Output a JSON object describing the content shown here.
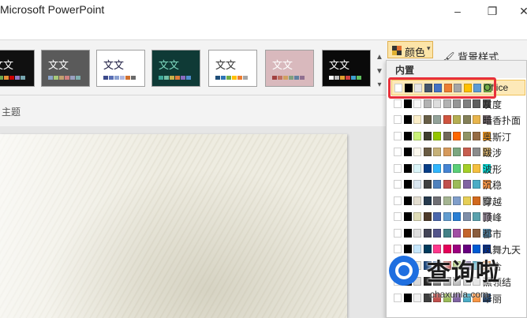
{
  "window": {
    "title": "Microsoft PowerPoint",
    "min_label": "–",
    "restore_label": "❐",
    "close_label": "✕"
  },
  "ribbon": {
    "group_label": "主题",
    "colors_button": "颜色",
    "bg_style": "背景样式",
    "themes": [
      {
        "text": "文文",
        "bg": "#101010",
        "fg": "#ffffff",
        "bars": [
          "#4a6fa5",
          "#6aa84f",
          "#e69138",
          "#cc0000",
          "#8e7cc3",
          "#76a5af"
        ]
      },
      {
        "text": "文文",
        "bg": "#5a5a5a",
        "fg": "#ffffff",
        "bars": [
          "#8aa4c8",
          "#a7c97a",
          "#c4a070",
          "#d08080",
          "#9aa0c0",
          "#80b0b0"
        ]
      },
      {
        "text": "文文",
        "bg": "#ffffff",
        "fg": "#1a1a40",
        "bars": [
          "#3c4a8a",
          "#5a70b5",
          "#8aa0d0",
          "#b0b8e0",
          "#d07030",
          "#6a6a6a"
        ]
      },
      {
        "text": "文文",
        "bg": "#0f3a36",
        "fg": "#7fd8c0",
        "bars": [
          "#3fa99a",
          "#74c0a8",
          "#c7b04a",
          "#e07b3c",
          "#8a6bbf",
          "#4f8fd0"
        ]
      },
      {
        "text": "文文",
        "bg": "#ffffff",
        "fg": "#333333",
        "bars": [
          "#1f4e79",
          "#2e75b6",
          "#70ad47",
          "#ffc000",
          "#ed7d31",
          "#a5a5a5"
        ]
      },
      {
        "text": "文文",
        "bg": "#d9b9bd",
        "fg": "#ffffff",
        "bars": [
          "#a04040",
          "#c07060",
          "#d0a060",
          "#80a080",
          "#6080a0",
          "#907090"
        ]
      },
      {
        "text": "文文",
        "bg": "#0a0a0a",
        "fg": "#ffffff",
        "bars": [
          "#ffffff",
          "#c0c0c0",
          "#e0a030",
          "#d04040",
          "#40a0d0",
          "#60c060"
        ]
      }
    ]
  },
  "dropdown": {
    "header": "内置",
    "rows": [
      {
        "label": "Office",
        "colors": [
          "#ffffff",
          "#000000",
          "#e7e6e6",
          "#44546a",
          "#4472c4",
          "#ed7d31",
          "#a5a5a5",
          "#ffc000",
          "#5b9bd5",
          "#70ad47"
        ],
        "hover": true
      },
      {
        "label": "灰度",
        "colors": [
          "#ffffff",
          "#000000",
          "#f8f8f8",
          "#b2b2b2",
          "#dddddd",
          "#b2b2b2",
          "#969696",
          "#808080",
          "#5f5f5f",
          "#4d4d4d"
        ]
      },
      {
        "label": "暗香扑面",
        "colors": [
          "#ffffff",
          "#000000",
          "#fbeec9",
          "#675e47",
          "#93a299",
          "#cf543f",
          "#b5ae53",
          "#848058",
          "#e8b54d",
          "#786c71"
        ]
      },
      {
        "label": "奥斯汀",
        "colors": [
          "#ffffff",
          "#000000",
          "#caf278",
          "#3e3d2d",
          "#94c600",
          "#71685a",
          "#ff6700",
          "#909465",
          "#956b43",
          "#fea022"
        ]
      },
      {
        "label": "跋涉",
        "colors": [
          "#ffffff",
          "#000000",
          "#fbf8ee",
          "#695b43",
          "#c6b178",
          "#d69a5c",
          "#7ca780",
          "#c75e4f",
          "#8c8c8c",
          "#d6b26f"
        ]
      },
      {
        "label": "波形",
        "colors": [
          "#ffffff",
          "#000000",
          "#dbf5f9",
          "#073e87",
          "#31b6fd",
          "#4584d3",
          "#5bd078",
          "#a5d028",
          "#f5c040",
          "#05e0db"
        ]
      },
      {
        "label": "沉稳",
        "colors": [
          "#ffffff",
          "#000000",
          "#d9e6f0",
          "#404040",
          "#4f81bd",
          "#c0504d",
          "#9bbb59",
          "#8064a2",
          "#4bacc6",
          "#f79646"
        ]
      },
      {
        "label": "穿越",
        "colors": [
          "#ffffff",
          "#000000",
          "#e3ded1",
          "#263a4d",
          "#6f6f74",
          "#a5b592",
          "#809eca",
          "#e6cf57",
          "#d2691e",
          "#a5a5a5"
        ]
      },
      {
        "label": "顶峰",
        "colors": [
          "#ffffff",
          "#000000",
          "#dfdcb7",
          "#4d3a2a",
          "#4a66ac",
          "#629dd1",
          "#297fd5",
          "#7f8fa9",
          "#5aa2ae",
          "#9d90a0"
        ]
      },
      {
        "label": "都市",
        "colors": [
          "#ffffff",
          "#000000",
          "#dedede",
          "#424456",
          "#53548a",
          "#438086",
          "#a04da3",
          "#c4652d",
          "#8b5d3d",
          "#5c92b5"
        ]
      },
      {
        "label": "凤舞九天",
        "colors": [
          "#ffffff",
          "#000000",
          "#c6e7fc",
          "#003b5c",
          "#ff388c",
          "#e40059",
          "#9c007f",
          "#68007f",
          "#005bd3",
          "#00349e"
        ]
      },
      {
        "label": "复合",
        "colors": [
          "#ffffff",
          "#000000",
          "#eeece1",
          "#1f497d",
          "#4f81bd",
          "#c0504d",
          "#9bbb59",
          "#8064a2",
          "#4bacc6",
          "#f79646"
        ]
      },
      {
        "label": "黑领结",
        "colors": [
          "#ffffff",
          "#000000",
          "#d9d9d9",
          "#262626",
          "#6f6f6f",
          "#a0a0a0",
          "#bfbfbf",
          "#cccccc",
          "#e6e6e6",
          "#f2f2f2"
        ]
      },
      {
        "label": "华丽",
        "colors": [
          "#ffffff",
          "#000000",
          "#f2f2f2",
          "#3f3f3f",
          "#c0504d",
          "#9bbb59",
          "#8064a2",
          "#4bacc6",
          "#f79646",
          "#2c4d75"
        ]
      }
    ]
  },
  "watermark": {
    "text": "查询啦",
    "url": "chaxunla.com"
  },
  "colors": {
    "highlight": "#e8303a",
    "hover_bg": "#fde9b8"
  }
}
